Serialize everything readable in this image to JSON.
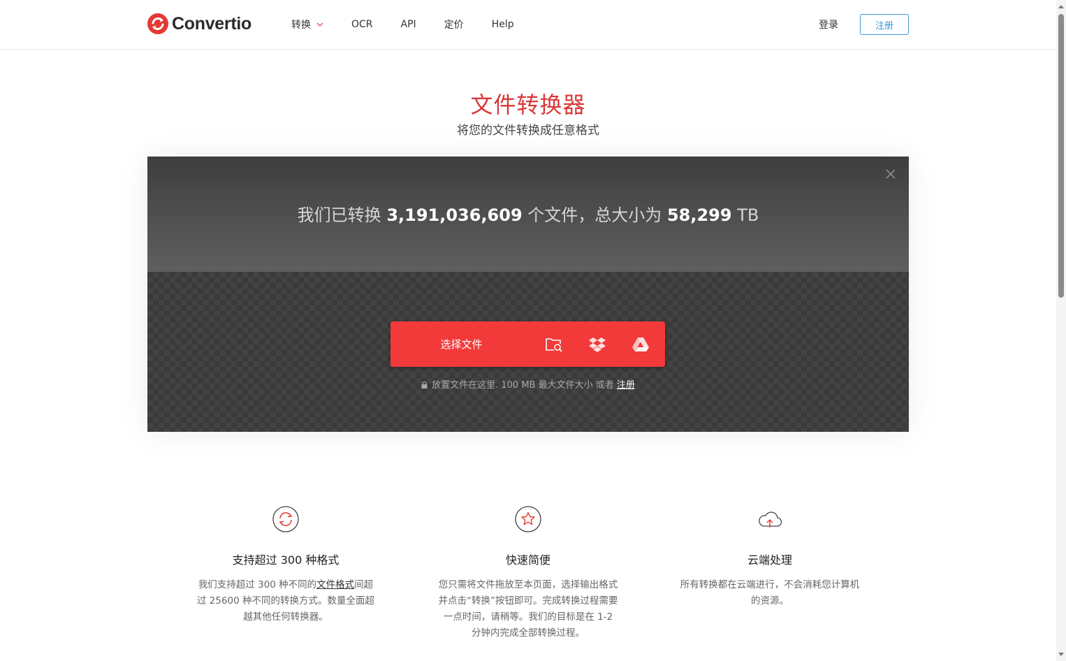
{
  "header": {
    "logo_text": "Convertio",
    "nav": [
      {
        "label": "转换",
        "has_dropdown": true
      },
      {
        "label": "OCR"
      },
      {
        "label": "API"
      },
      {
        "label": "定价"
      },
      {
        "label": "Help"
      }
    ],
    "login_label": "登录",
    "signup_label": "注册"
  },
  "hero": {
    "title": "文件转换器",
    "subtitle": "将您的文件转换成任意格式"
  },
  "stats": {
    "prefix": "我们已转换",
    "files_count": "3,191,036,609",
    "middle": "个文件，总大小为",
    "total_size": "58,299",
    "unit": "TB"
  },
  "upload": {
    "choose_label": "选择文件",
    "sources": [
      "folder-search-icon",
      "dropbox-icon",
      "google-drive-icon"
    ],
    "note_text": "放置文件在这里. 100 MB 最大文件大小 或者",
    "note_link": "注册"
  },
  "features": [
    {
      "icon": "refresh-icon",
      "title": "支持超过 300 种格式",
      "text_before": "我们支持超过 300 种不同的",
      "link": "文件格式",
      "text_after": "间超过 25600 种不同的转换方式。数量全面超越其他任何转换器。"
    },
    {
      "icon": "star-icon",
      "title": "快速简便",
      "text": "您只需将文件拖放至本页面，选择输出格式并点击“转换”按钮即可。完成转换过程需要一点时间，请稍等。我们的目标是在 1-2 分钟内完成全部转换过程。"
    },
    {
      "icon": "cloud-upload-icon",
      "title": "云端处理",
      "text": "所有转换都在云端进行，不会消耗您计算机的资源。"
    }
  ],
  "colors": {
    "brand_red": "#f23a3a",
    "title_red": "#d93838",
    "signup_blue": "#3a97d6"
  }
}
